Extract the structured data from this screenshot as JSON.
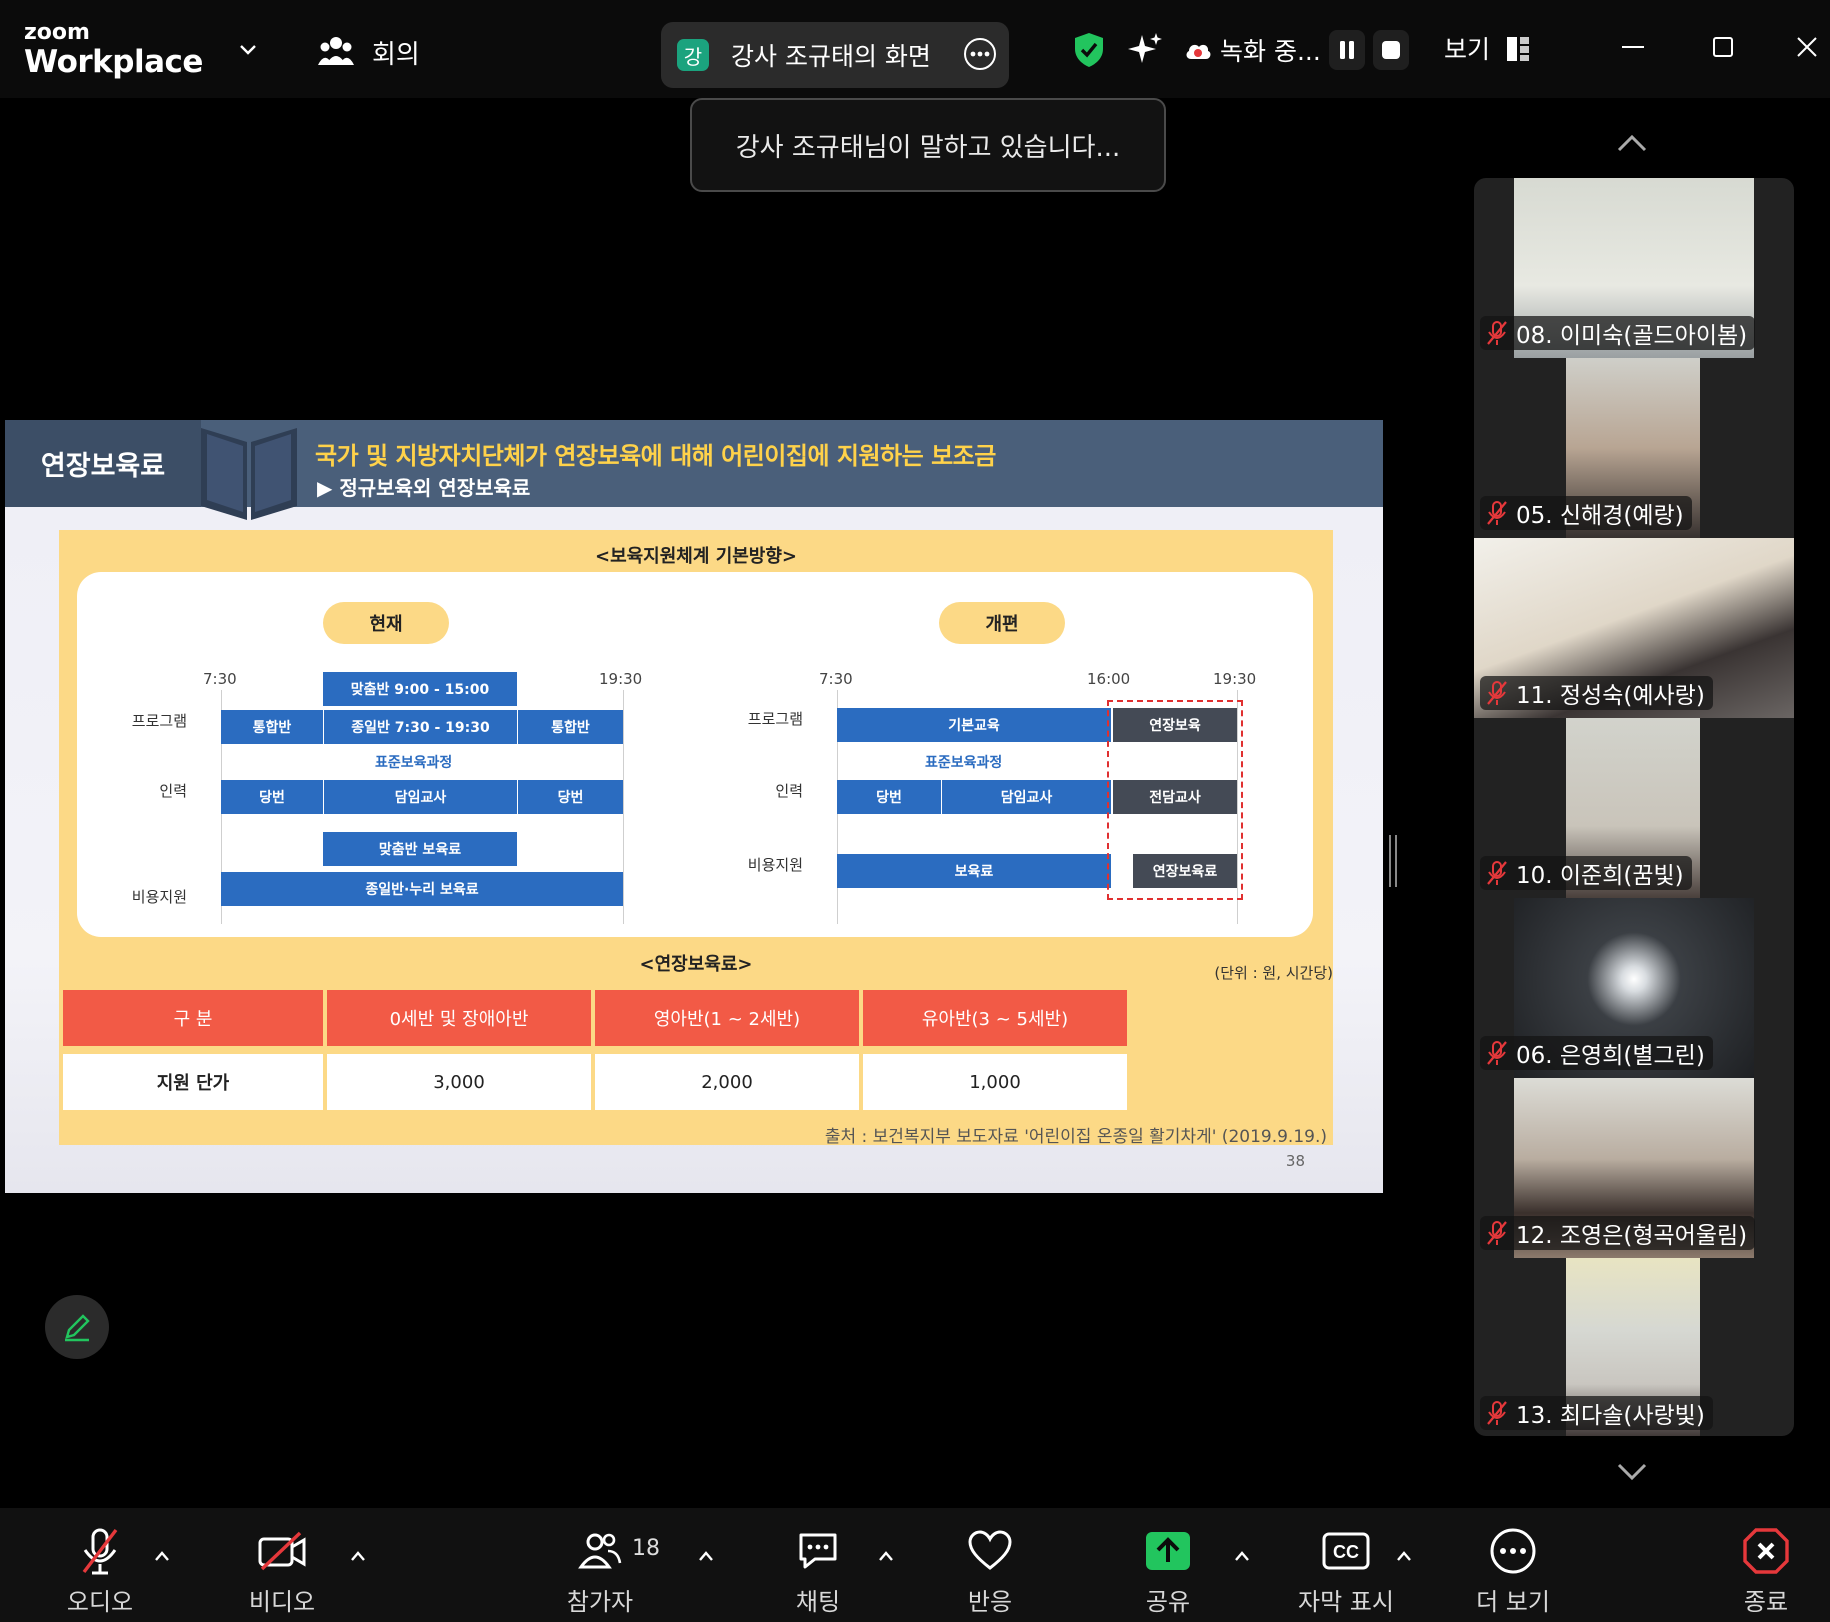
{
  "app": {
    "logo_top": "zoom",
    "logo_bottom": "Workplace"
  },
  "header": {
    "meeting_label": "회의",
    "share_badge": "강",
    "share_label": "강사 조규태의 화면",
    "recording_label": "녹화 중...",
    "view_label": "보기"
  },
  "toast": {
    "text": "강사 조규태님이 말하고 있습니다..."
  },
  "slide": {
    "tag": "연장보육료",
    "title": "국가 및 지방자치단체가 연장보육에 대해 어린이집에 지원하는 보조금",
    "subtitle": "▶ 정규보육외 연장보육료",
    "panel_title": "<보육지원체계 기본방향>",
    "left": {
      "pill": "현재",
      "t1": "7:30",
      "t2": "19:30",
      "row_program": "프로그램",
      "row_staff": "인력",
      "row_cost": "비용지원",
      "matchum": "맞춤반 9:00 - 15:00",
      "tonghap1": "통합반",
      "jongil": "종일반 7:30 - 19:30",
      "tonghap2": "통합반",
      "std": "표준보육과정",
      "dangbeon1": "당번",
      "damim": "담임교사",
      "dangbeon2": "당번",
      "matchum_fee": "맞춤반 보육료",
      "jongil_fee": "종일반·누리 보육료"
    },
    "right": {
      "pill": "개편",
      "t1": "7:30",
      "t2": "16:00",
      "t3": "19:30",
      "row_program": "프로그램",
      "row_staff": "인력",
      "row_cost": "비용지원",
      "basic": "기본교육",
      "ext": "연장보육",
      "std": "표준보육과정",
      "dangbeon": "당번",
      "damim": "담임교사",
      "dedicated": "전담교사",
      "fee": "보육료",
      "ext_fee": "연장보육료"
    },
    "table_title": "<연장보육료>",
    "unit": "(단위 : 원, 시간당)",
    "table_headers": [
      "구 분",
      "0세반 및 장애아반",
      "영아반(1 ~ 2세반)",
      "유아반(3 ~ 5세반)"
    ],
    "table_row": [
      "지원 단가",
      "3,000",
      "2,000",
      "1,000"
    ],
    "source": "출처 : 보건복지부 보도자료 '어린이집 온종일 활기차게' (2019.9.19.)",
    "page": "38"
  },
  "participants": [
    {
      "name": "08. 이미숙(골드아이봄)"
    },
    {
      "name": "05. 신해경(예랑)"
    },
    {
      "name": "11. 정성숙(예사랑)"
    },
    {
      "name": "10. 이준희(꿈빛)"
    },
    {
      "name": "06. 은영희(별그린)"
    },
    {
      "name": "12. 조영은(형곡어울림)"
    },
    {
      "name": "13. 최다솔(사랑빛)"
    }
  ],
  "toolbar": {
    "audio": "오디오",
    "video": "비디오",
    "participants": "참가자",
    "participants_count": "18",
    "chat": "채팅",
    "react": "반응",
    "share": "공유",
    "captions": "자막 표시",
    "more": "더 보기",
    "end": "종료"
  },
  "colors": {
    "accent_green": "#22c55e",
    "end_red": "#e5383b",
    "slide_header": "#4a5f7a",
    "bar_blue": "#2b6cc0",
    "panel_yellow": "#fcd986",
    "table_red": "#f25a46"
  }
}
